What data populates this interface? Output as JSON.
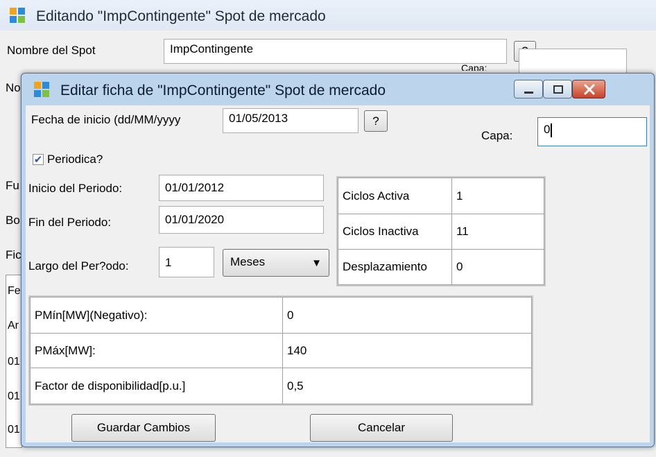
{
  "parent": {
    "title": "Editando \"ImpContingente\" Spot de mercado",
    "nombre_label": "Nombre del Spot",
    "nombre_value": "ImpContingente",
    "help_label": "?",
    "capa_label_partial": "Capa:",
    "left_partial_labels": [
      "No",
      "Fu",
      "Bo",
      "Fic"
    ],
    "grid_partial_cells": [
      "Fe",
      "Ar",
      "01",
      "01",
      "01"
    ]
  },
  "dialog": {
    "title": "Editar ficha de  \"ImpContingente\" Spot de mercado",
    "fecha_inicio_label": "Fecha de inicio (dd/MM/yyyy",
    "fecha_inicio_value": "01/05/2013",
    "help_label": "?",
    "capa_label": "Capa:",
    "capa_value": "0",
    "periodica_label": "Periodica?",
    "periodica_checked": true,
    "inicio_periodo_label": "Inicio del Periodo:",
    "inicio_periodo_value": "01/01/2012",
    "fin_periodo_label": "Fin del Periodo:",
    "fin_periodo_value": "01/01/2020",
    "largo_periodo_label": "Largo del Per?odo:",
    "largo_periodo_value": "1",
    "unidad_selected": "Meses",
    "cycles": [
      {
        "label": "Ciclos Activa",
        "value": "1"
      },
      {
        "label": "Ciclos Inactiva",
        "value": "11"
      },
      {
        "label": "Desplazamiento",
        "value": "0"
      }
    ],
    "params": [
      {
        "label": "PMín[MW](Negativo):",
        "value": "0"
      },
      {
        "label": "PMáx[MW]:",
        "value": "140"
      },
      {
        "label": "Factor de disponibilidad[p.u.]",
        "value": "0,5"
      }
    ],
    "save_label": "Guardar Cambios",
    "cancel_label": "Cancelar"
  }
}
